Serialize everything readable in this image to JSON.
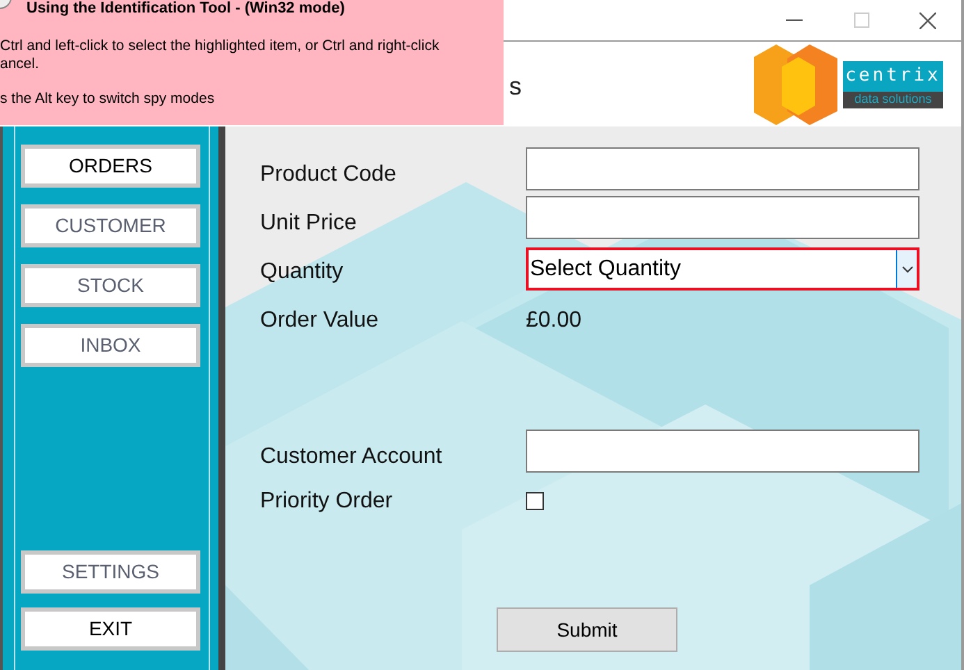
{
  "tooltip": {
    "title": "Using the Identification Tool - (Win32 mode)",
    "lines": [
      "Ctrl and left-click to select the highlighted item, or Ctrl and right-click",
      "ancel.",
      "s the Alt key to switch spy modes"
    ]
  },
  "header": {
    "title_fragment": "s",
    "logo": {
      "name": "centrix",
      "tagline": "data solutions"
    }
  },
  "sidebar": {
    "top_items": [
      {
        "label": "ORDERS",
        "dimmed": false
      },
      {
        "label": "CUSTOMER",
        "dimmed": true
      },
      {
        "label": "STOCK",
        "dimmed": true
      },
      {
        "label": "INBOX",
        "dimmed": true
      }
    ],
    "bottom_items": [
      {
        "label": "SETTINGS",
        "dimmed": true
      },
      {
        "label": "EXIT",
        "dimmed": false
      }
    ]
  },
  "form": {
    "rows": [
      {
        "kind": "text",
        "label": "Product Code"
      },
      {
        "kind": "text",
        "label": "Unit Price"
      },
      {
        "kind": "select",
        "label": "Quantity",
        "value": "Select Quantity",
        "invalid": true
      },
      {
        "kind": "value",
        "label": "Order Value",
        "value": "£0.00"
      },
      {
        "kind": "gap"
      },
      {
        "kind": "text",
        "label": "Customer Account"
      },
      {
        "kind": "checkbox",
        "label": "Priority Order",
        "checked": false
      }
    ],
    "submit": "Submit"
  }
}
